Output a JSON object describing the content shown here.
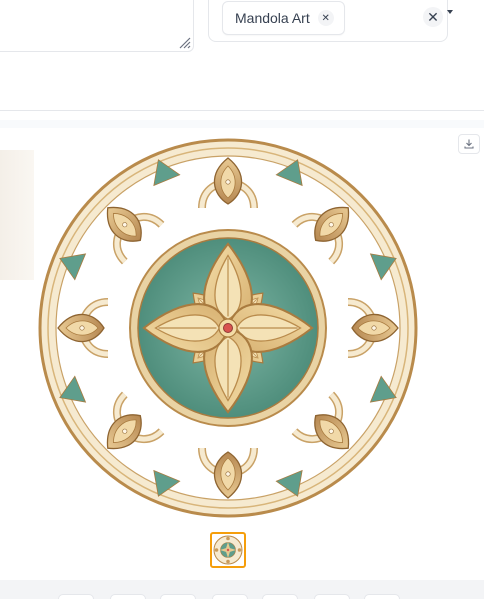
{
  "tags_dropdown": {
    "selected_tags": [
      {
        "label": "Mandola Art"
      }
    ],
    "icons": {
      "remove": "close-icon",
      "clear": "close-icon",
      "expand": "chevron-down-icon"
    }
  },
  "gallery": {
    "download_icon": "download-icon",
    "thumbnail_count": 1,
    "selected_thumbnail": 0
  },
  "colors": {
    "accent_border": "#f59e0b",
    "mandala_teal": "#5f9e8c",
    "mandala_gold": "#e6c98f",
    "mandala_cream": "#f6ead0",
    "mandala_outline": "#b98b4c",
    "center_dot": "#d9534f"
  }
}
